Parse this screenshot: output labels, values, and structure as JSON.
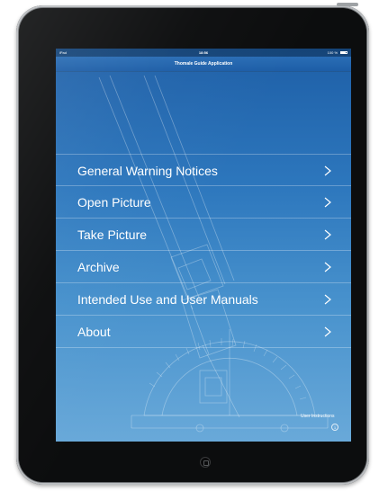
{
  "device": {
    "status_bar": {
      "device_name": "iPad",
      "time": "18:56",
      "battery_text": "100 %",
      "battery_level": 0.9
    },
    "home_button_icon": "home-button"
  },
  "app": {
    "title": "Thomale Guide Application",
    "menu": [
      {
        "label": "General Warning Notices",
        "icon": "chevron-right-icon"
      },
      {
        "label": "Open Picture",
        "icon": "chevron-right-icon"
      },
      {
        "label": "Take Picture",
        "icon": "chevron-right-icon"
      },
      {
        "label": "Archive",
        "icon": "chevron-right-icon"
      },
      {
        "label": "Intended Use and User Manuals",
        "icon": "chevron-right-icon"
      },
      {
        "label": "About",
        "icon": "chevron-right-icon"
      }
    ],
    "user_instructions_label": "User Instructions",
    "info_icon_glyph": "i",
    "colors": {
      "screen_top": "#1e5fa7",
      "screen_bottom": "#69a9d9",
      "text": "#ffffff"
    }
  }
}
